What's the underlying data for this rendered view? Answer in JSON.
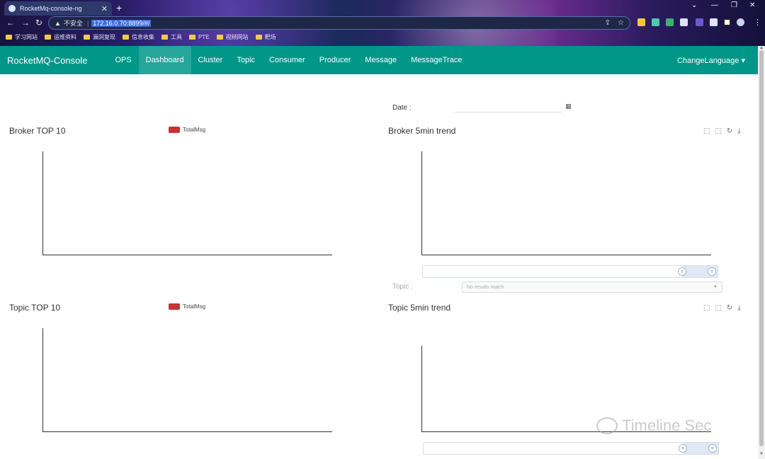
{
  "browser": {
    "tab_title": "RocketMq-console-ng",
    "insecure_label": "不安全",
    "url": "172.16.0.70:8899/#/",
    "bookmarks": [
      "学习网站",
      "运维资料",
      "漏洞复现",
      "信息收集",
      "工具",
      "PTE",
      "视频网站",
      "靶场"
    ]
  },
  "nav": {
    "brand": "RocketMQ-Console",
    "items": [
      "OPS",
      "Dashboard",
      "Cluster",
      "Topic",
      "Consumer",
      "Producer",
      "Message",
      "MessageTrace"
    ],
    "active": "Dashboard",
    "language": "ChangeLanguage"
  },
  "dashboard": {
    "date_label": "Date :",
    "broker_top_title": "Broker TOP 10",
    "broker_trend_title": "Broker 5min trend",
    "topic_top_title": "Topic TOP 10",
    "topic_trend_title": "Topic 5min trend",
    "legend_label": "TotalMsg",
    "topic_select_label": "Topic :",
    "topic_select_placeholder": "No results match"
  },
  "watermark": "Timeline Sec",
  "colors": {
    "navbar": "#009688",
    "navbar_active": "#26a69a",
    "legend_swatch": "#c23531"
  }
}
